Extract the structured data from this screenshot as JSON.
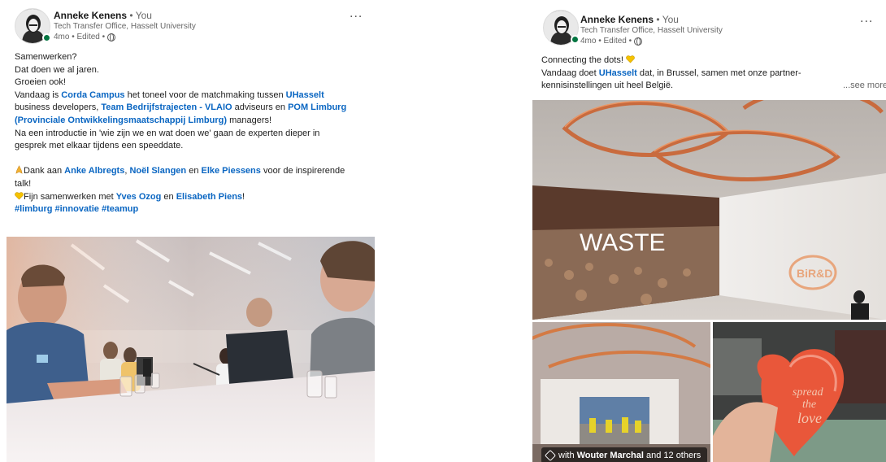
{
  "left_post": {
    "author": "Anneke Kenens",
    "you_label": "• You",
    "headline": "Tech Transfer Office, Hasselt University",
    "meta": "4mo • Edited •",
    "more": "...",
    "body": {
      "l1": "Samenwerken?",
      "l2": "Dat doen we al jaren.",
      "l3": "Groeien ook!",
      "l4a": "Vandaag is ",
      "l4_link1": "Corda Campus",
      "l4b": " het toneel voor de matchmaking tussen ",
      "l4_link2": "UHasselt",
      "l5a": "business developers, ",
      "l5_link": "Team Bedrijfstrajecten - VLAIO",
      "l5b": " adviseurs en ",
      "l5_link2": "POM Limburg",
      "l6_link": "(Provinciale Ontwikkelingsmaatschappij Limburg)",
      "l6b": " managers!",
      "l7": "Na een introductie in 'wie zijn we en wat doen we' gaan de experten dieper in",
      "l8": "gesprek met elkaar tijdens een speeddate.",
      "l9a": "Dank aan ",
      "l9_link1": "Anke Albregts",
      "l9_sep": ", ",
      "l9_link2": "Noël Slangen",
      "l9_en": " en ",
      "l9_link3": "Elke Piessens",
      "l9b": " voor de inspirerende",
      "l10": "talk!",
      "l11a": "Fijn samenwerken met ",
      "l11_link1": "Yves Ozog",
      "l11_en": " en ",
      "l11_link2": "Elisabeth Piens",
      "l11b": "!",
      "hashtags": "#limburg #innovatie #teamup"
    }
  },
  "right_post": {
    "author": "Anneke Kenens",
    "you_label": "• You",
    "headline": "Tech Transfer Office, Hasselt University",
    "meta": "4mo • Edited •",
    "more": "...",
    "body": {
      "l1": "Connecting the dots!",
      "l2a": "Vandaag doet ",
      "l2_link": "UHasselt",
      "l2b": " dat, in Brussel, samen met onze partner-",
      "l3": "kennisinstellingen uit heel België.",
      "see_more": "...see more"
    },
    "slide_word": "WASTE",
    "logo_text": "BiR&D",
    "card_text": [
      "spread",
      "the",
      "love"
    ],
    "tag": {
      "prefix": "with ",
      "name": "Wouter Marchal",
      "suffix": " and 12 others"
    }
  },
  "colors": {
    "link": "#0a66c2",
    "online": "#057642"
  }
}
